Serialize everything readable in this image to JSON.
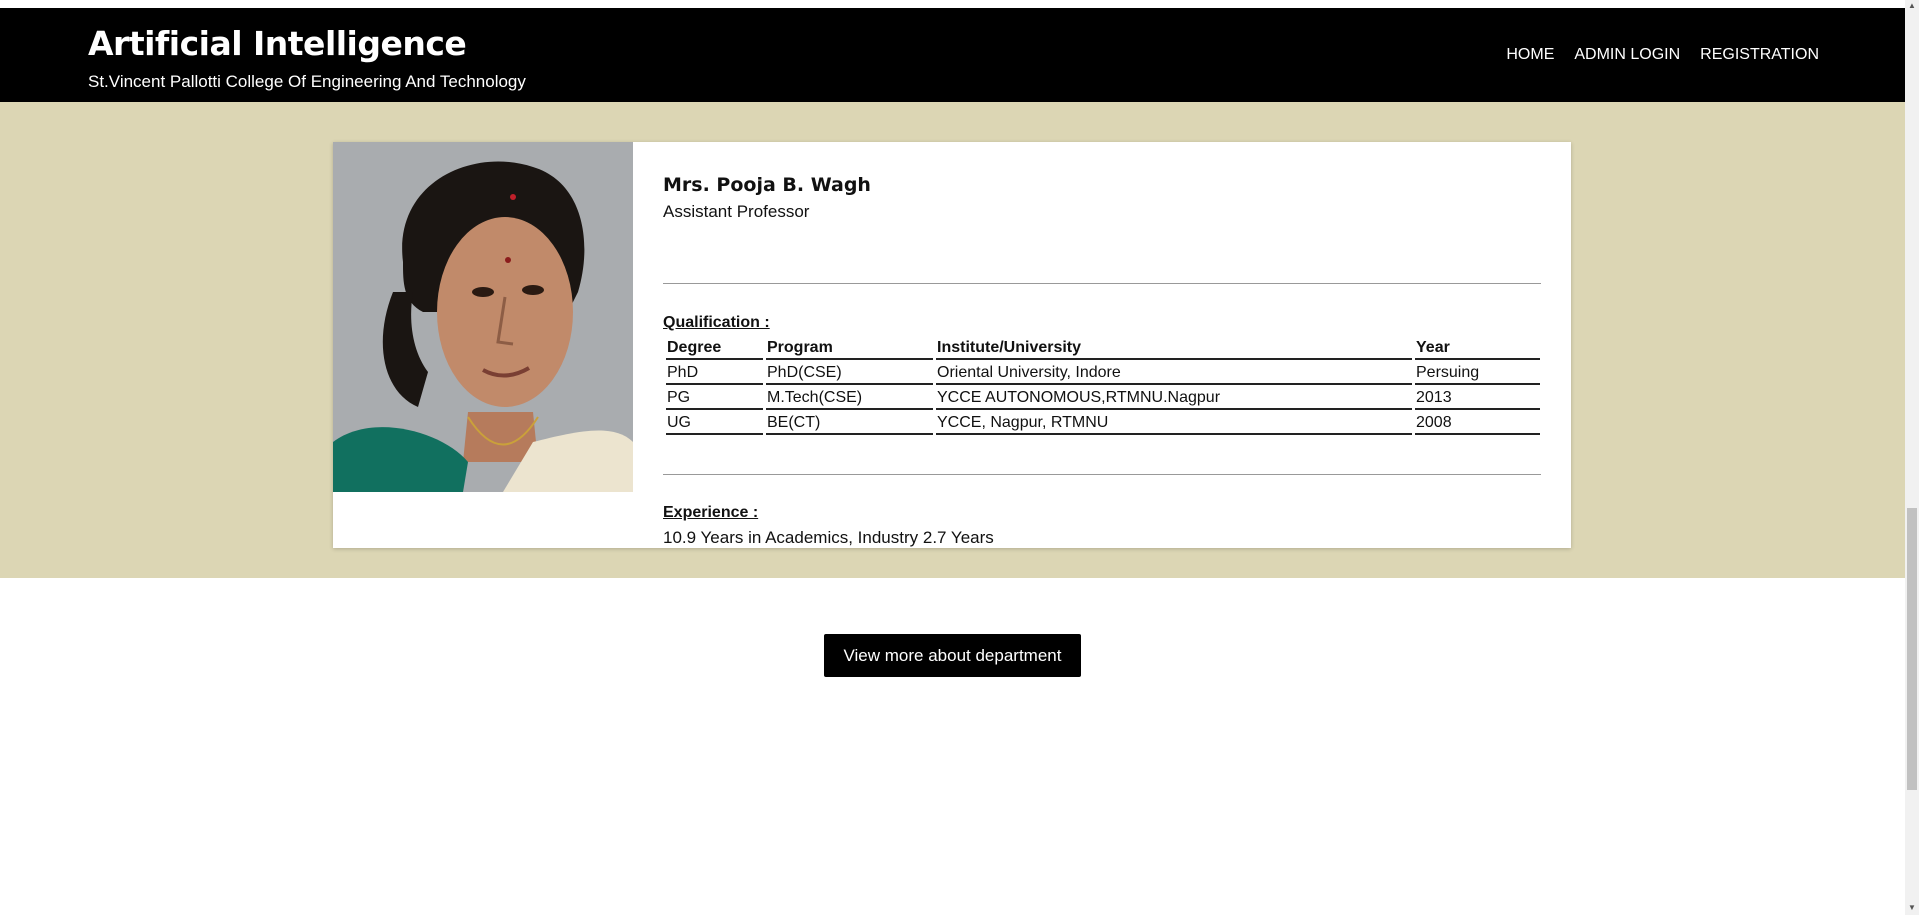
{
  "header": {
    "title": "Artificial Intelligence",
    "subtitle": "St.Vincent Pallotti College Of Engineering And Technology",
    "nav": [
      "HOME",
      "ADMIN LOGIN",
      "REGISTRATION"
    ]
  },
  "profile": {
    "name": "Mrs. Pooja B. Wagh",
    "role": "Assistant Professor",
    "qualification_title": "Qualification :",
    "columns": [
      "Degree",
      "Program",
      "Institute/University",
      "Year"
    ],
    "rows": [
      [
        "PhD",
        "PhD(CSE)",
        "Oriental University, Indore",
        "Persuing"
      ],
      [
        "PG",
        "M.Tech(CSE)",
        "YCCE AUTONOMOUS,RTMNU.Nagpur",
        "2013"
      ],
      [
        "UG",
        "BE(CT)",
        "YCCE, Nagpur, RTMNU",
        "2008"
      ]
    ],
    "experience_title": "Experience :",
    "experience_text": "10.9 Years in Academics, Industry 2.7 Years"
  },
  "cta": {
    "label": "View more about department"
  },
  "colors": {
    "band": "#dcd6b4",
    "header": "#000000"
  }
}
